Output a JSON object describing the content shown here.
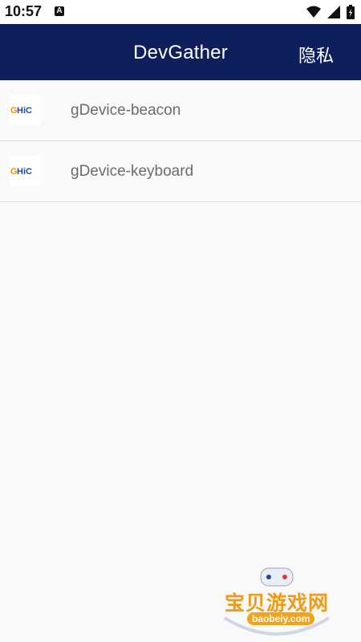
{
  "status_bar": {
    "time": "10:57",
    "icons": [
      "a-icon",
      "wifi-icon",
      "signal-icon",
      "battery-icon"
    ]
  },
  "toolbar": {
    "title": "DevGather",
    "privacy_label": "隐私",
    "background": "#0f1f5c"
  },
  "apps": [
    {
      "name": "gDevice-beacon",
      "logo_text": "GHiC"
    },
    {
      "name": "gDevice-keyboard",
      "logo_text": "GHiC"
    }
  ],
  "watermark": {
    "title": "宝贝游戏网",
    "url": "baobeiy.com"
  }
}
